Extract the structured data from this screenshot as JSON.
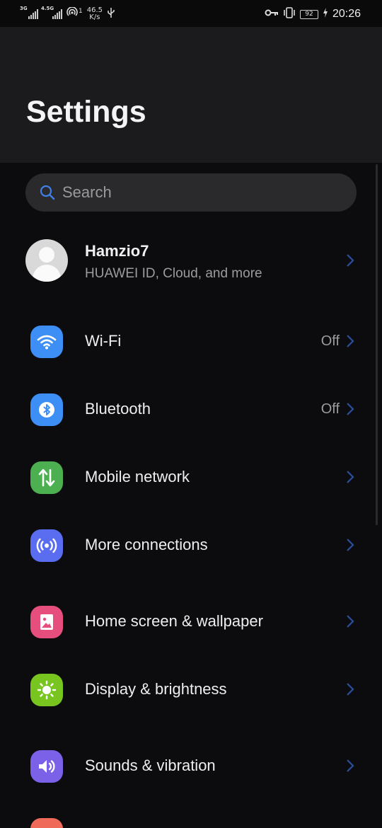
{
  "status_bar": {
    "network_3g": "3G",
    "network_4g": "4.5G",
    "hotspot_count": "1",
    "speed_value": "46.5",
    "speed_unit": "K/s",
    "battery": "92",
    "time": "20:26",
    "icons": [
      "signal-3g-icon",
      "signal-4g-icon",
      "hotspot-icon",
      "usb-icon",
      "vpn-key-icon",
      "vibrate-icon",
      "battery-icon",
      "charging-icon"
    ]
  },
  "header": {
    "title": "Settings"
  },
  "search": {
    "placeholder": "Search"
  },
  "profile": {
    "name": "Hamzio7",
    "subtitle": "HUAWEI ID, Cloud, and more"
  },
  "items": [
    {
      "label": "Wi-Fi",
      "value": "Off",
      "icon": "wifi-icon",
      "color": "#3d8ff5"
    },
    {
      "label": "Bluetooth",
      "value": "Off",
      "icon": "bluetooth-icon",
      "color": "#3d8ff5"
    },
    {
      "label": "Mobile network",
      "value": "",
      "icon": "mobile-data-icon",
      "color": "#4caf50"
    },
    {
      "label": "More connections",
      "value": "",
      "icon": "more-connections-icon",
      "color": "#5a6cf0"
    },
    {
      "label": "Home screen & wallpaper",
      "value": "",
      "icon": "wallpaper-icon",
      "color": "#e64e7e"
    },
    {
      "label": "Display & brightness",
      "value": "",
      "icon": "brightness-icon",
      "color": "#79c51f"
    },
    {
      "label": "Sounds & vibration",
      "value": "",
      "icon": "sound-icon",
      "color": "#7b61e8"
    }
  ],
  "colors": {
    "background": "#0c0c0e",
    "header": "#1b1b1d",
    "chevron": "#2a4fa0",
    "notifications_partial": "#f06a5a"
  }
}
